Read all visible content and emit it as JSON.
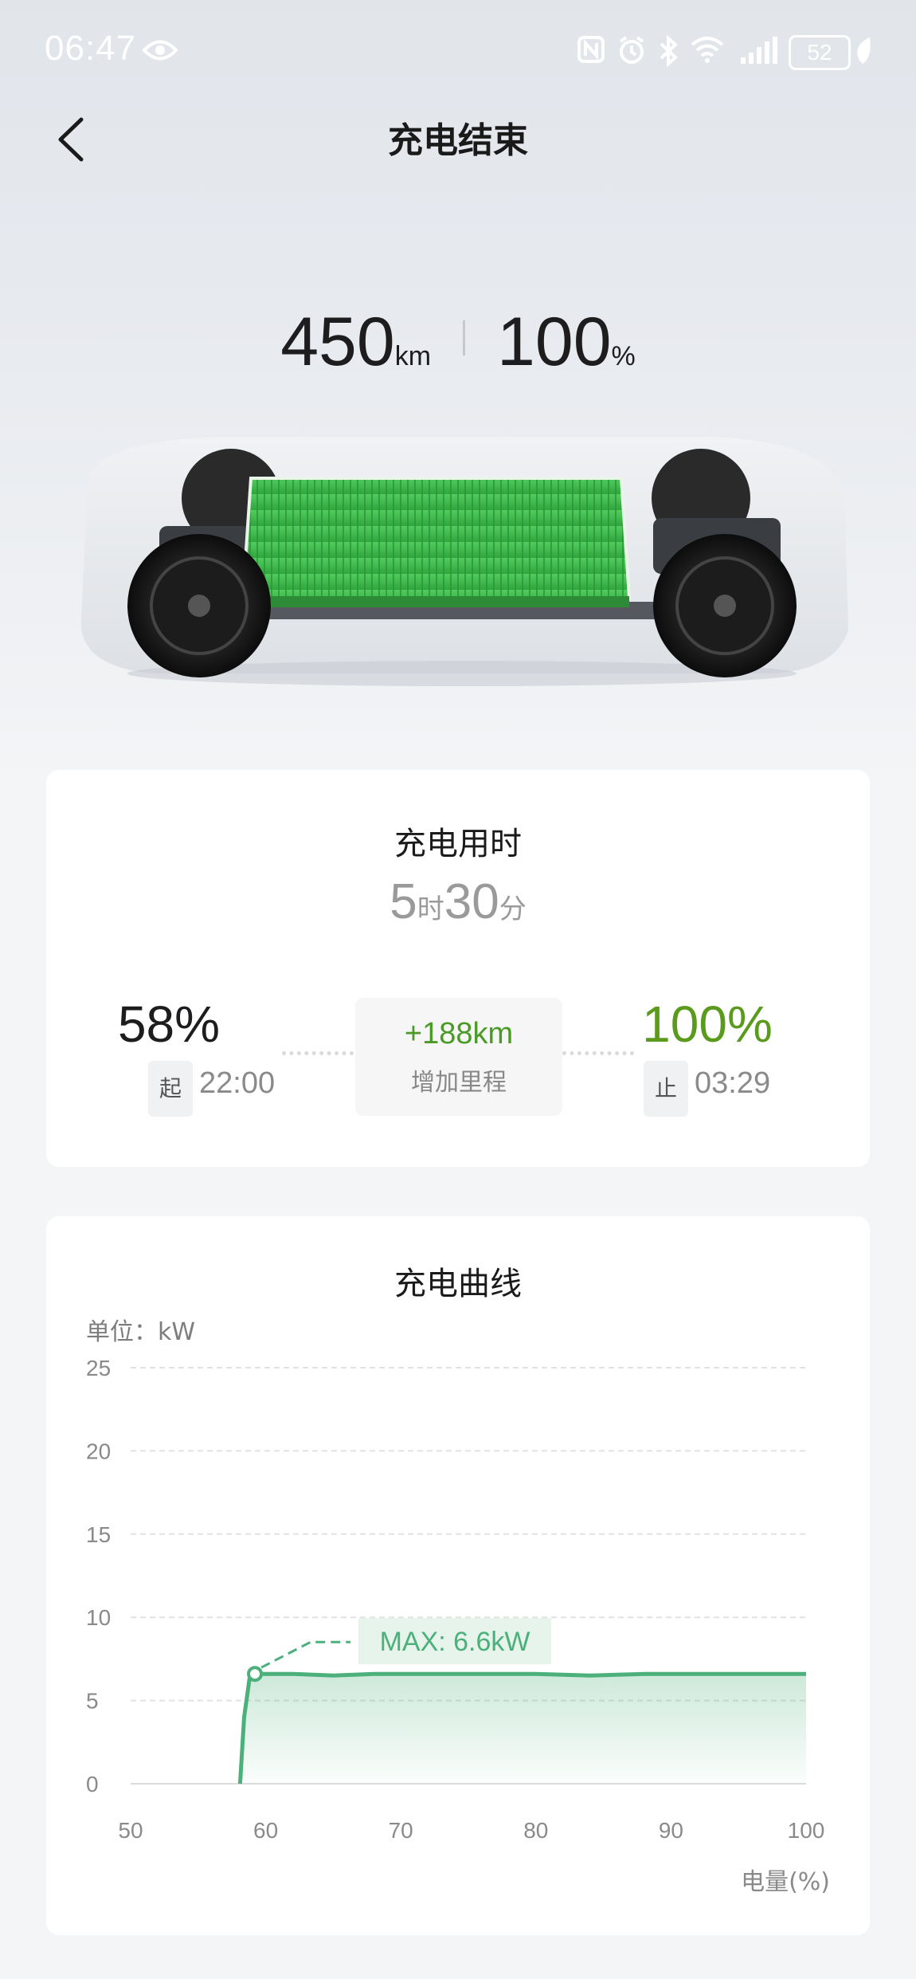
{
  "status_bar": {
    "time": "06:47",
    "battery": "52",
    "icons": [
      "eye-icon",
      "nfc-icon",
      "alarm-icon",
      "bluetooth-icon",
      "wifi-icon",
      "signal-icon",
      "battery-icon",
      "leaf-icon"
    ]
  },
  "header": {
    "title": "充电结束"
  },
  "summary": {
    "range_value": "450",
    "range_unit": "km",
    "soc_value": "100",
    "soc_unit": "%",
    "battery_fill_color": "#3cb64a"
  },
  "charge_time_card": {
    "title": "充电用时",
    "hours": "5",
    "hours_unit": "时",
    "minutes": "30",
    "minutes_unit": "分",
    "start": {
      "percent": "58%",
      "tag": "起",
      "time": "22:00"
    },
    "added": {
      "value": "+188km",
      "label": "增加里程"
    },
    "end": {
      "percent": "100%",
      "tag": "止",
      "time": "03:29"
    },
    "end_color": "#5a9a1c"
  },
  "curve_card": {
    "title": "充电曲线",
    "unit_label": "单位：kW",
    "x_axis_title": "电量(%)",
    "max_label": "MAX: 6.6kW",
    "line_color": "#4bb07a"
  },
  "chart_data": {
    "type": "area",
    "title": "充电曲线",
    "xlabel": "电量(%)",
    "ylabel": "单位：kW",
    "xlim": [
      50,
      100
    ],
    "ylim": [
      0,
      25
    ],
    "x_ticks": [
      50,
      60,
      70,
      80,
      90,
      100
    ],
    "y_ticks": [
      0,
      5,
      10,
      15,
      20,
      25
    ],
    "grid": true,
    "series": [
      {
        "x": [
          58.1,
          58.4,
          58.8,
          59.2,
          62,
          65,
          68,
          72,
          76,
          80,
          84,
          88,
          92,
          96,
          100
        ],
        "y": [
          0,
          4,
          6.3,
          6.6,
          6.6,
          6.5,
          6.6,
          6.6,
          6.6,
          6.6,
          6.5,
          6.6,
          6.6,
          6.6,
          6.6
        ]
      }
    ],
    "annotations": [
      {
        "text": "MAX: 6.6kW",
        "x": 59.2,
        "y": 6.6
      }
    ]
  }
}
